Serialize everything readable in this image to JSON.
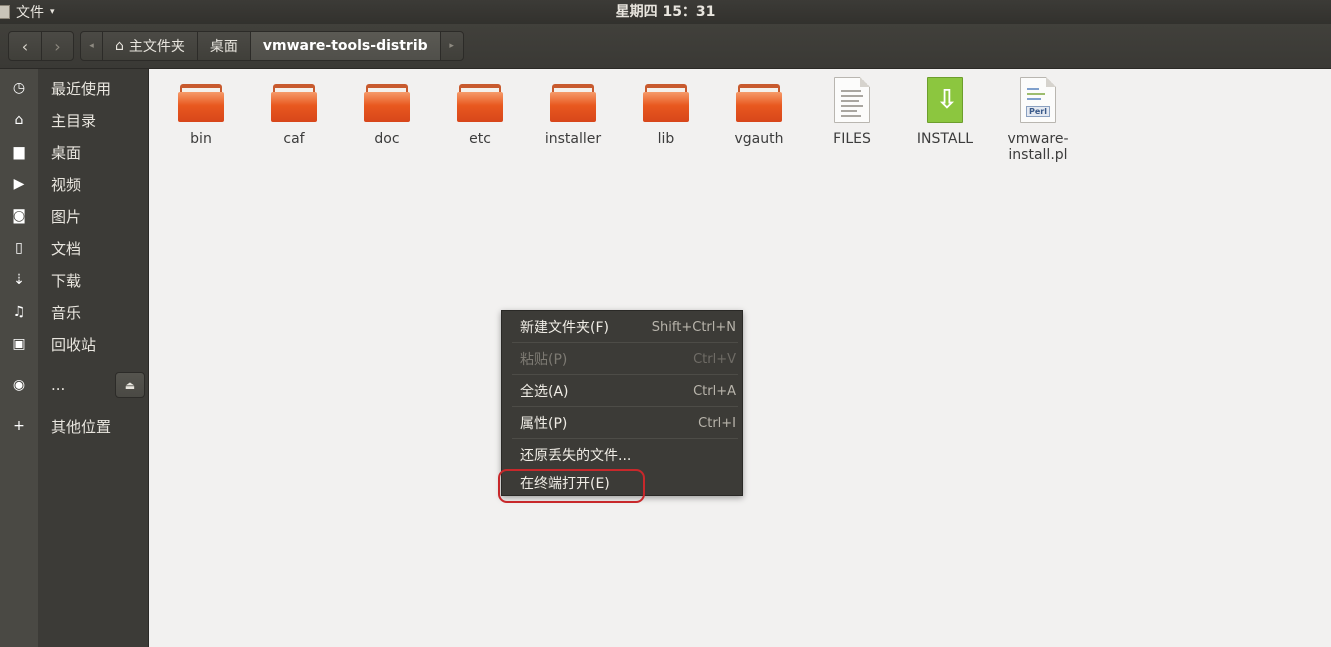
{
  "top_panel": {
    "app_menu_label": "文件",
    "app_menu_caret": "▾",
    "clock": "星期四 15：31"
  },
  "toolbar": {
    "back_glyph": "‹",
    "forward_glyph": "›",
    "path_scroll_left": "◂",
    "path_scroll_right": "▸",
    "path": [
      {
        "label": "主文件夹",
        "icon": "home-icon"
      },
      {
        "label": "桌面"
      },
      {
        "label": "vmware-tools-distrib",
        "current": true
      }
    ]
  },
  "sidebar": {
    "items": [
      {
        "label": "最近使用",
        "icon": "recent-icon"
      },
      {
        "label": "主目录",
        "icon": "home-icon"
      },
      {
        "label": "桌面",
        "icon": "folder-icon"
      },
      {
        "label": "视频",
        "icon": "video-icon"
      },
      {
        "label": "图片",
        "icon": "camera-icon"
      },
      {
        "label": "文档",
        "icon": "document-icon"
      },
      {
        "label": "下载",
        "icon": "download-icon"
      },
      {
        "label": "音乐",
        "icon": "music-icon"
      },
      {
        "label": "回收站",
        "icon": "trash-icon"
      },
      {
        "label": "...",
        "icon": "disc-icon"
      },
      {
        "label": "其他位置",
        "icon": "plus-icon"
      }
    ],
    "eject_glyph": "⏏"
  },
  "files": [
    {
      "name": "bin",
      "type": "folder"
    },
    {
      "name": "caf",
      "type": "folder"
    },
    {
      "name": "doc",
      "type": "folder"
    },
    {
      "name": "etc",
      "type": "folder"
    },
    {
      "name": "installer",
      "type": "folder"
    },
    {
      "name": "lib",
      "type": "folder"
    },
    {
      "name": "vgauth",
      "type": "folder"
    },
    {
      "name": "FILES",
      "type": "text"
    },
    {
      "name": "INSTALL",
      "type": "install"
    },
    {
      "name": "vmware-install.pl",
      "name_line1": "vmware-",
      "name_line2": "install.pl",
      "type": "perl",
      "badge": "Perl"
    }
  ],
  "context_menu": {
    "items": [
      {
        "label": "新建文件夹(F)",
        "accel": "Shift+Ctrl+N",
        "enabled": true
      },
      {
        "label": "粘贴(P)",
        "accel": "Ctrl+V",
        "enabled": false
      },
      {
        "label": "全选(A)",
        "accel": "Ctrl+A",
        "enabled": true
      },
      {
        "label": "属性(P)",
        "accel": "Ctrl+I",
        "enabled": true
      },
      {
        "label": "还原丢失的文件...",
        "accel": "",
        "enabled": true
      },
      {
        "label": "在终端打开(E)",
        "accel": "",
        "enabled": true,
        "highlighted": true
      }
    ],
    "highlight_color": "#c8282b"
  }
}
